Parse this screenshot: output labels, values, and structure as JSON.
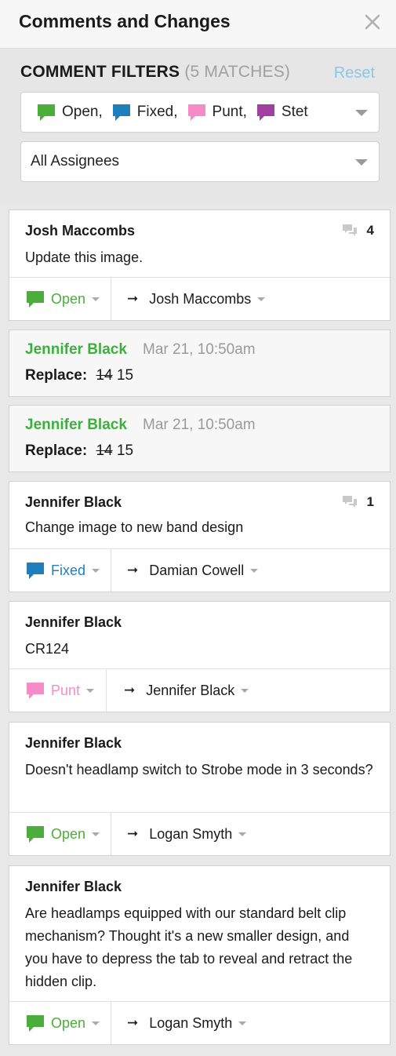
{
  "panel": {
    "title": "Comments and Changes",
    "close_symbol": "✕"
  },
  "filters": {
    "title": "COMMENT FILTERS",
    "matches": "(5 MATCHES)",
    "reset_label": "Reset",
    "statuses": [
      {
        "label": "Open,",
        "icon": "comment-bubble-green-icon",
        "color": "#4cae3a"
      },
      {
        "label": "Fixed,",
        "icon": "comment-bubble-blue-icon",
        "color": "#1f7fbd"
      },
      {
        "label": "Punt,",
        "icon": "comment-bubble-pink-icon",
        "color": "#f58cc8"
      },
      {
        "label": "Stet",
        "icon": "comment-bubble-purple-icon",
        "color": "#a040a0"
      }
    ],
    "assignee_select": "All Assignees"
  },
  "cards": [
    {
      "author": "Josh Maccombs",
      "body": "Update this image.",
      "reply_count": "4",
      "status": "Open",
      "status_color": "#4cae3a",
      "assignee": "Josh Maccombs",
      "arrow": "➞"
    },
    {
      "author": "Jennifer Black",
      "date": "Mar 21, 10:50am",
      "replace_label": "Replace:",
      "old": "14",
      "new": "15"
    },
    {
      "author": "Jennifer Black",
      "date": "Mar 21, 10:50am",
      "replace_label": "Replace:",
      "old": "14",
      "new": "15"
    },
    {
      "author": "Jennifer Black",
      "body": "Change image to new band design",
      "reply_count": "1",
      "status": "Fixed",
      "status_color": "#1f7fbd",
      "assignee": "Damian Cowell",
      "arrow": "➞"
    },
    {
      "author": "Jennifer Black",
      "body": "CR124",
      "status": "Punt",
      "status_color": "#f58cc8",
      "assignee": "Jennifer Black",
      "arrow": "➞"
    },
    {
      "author": "Jennifer Black",
      "body": "Doesn't headlamp switch to Strobe mode in  3 seconds?",
      "status": "Open",
      "status_color": "#4cae3a",
      "assignee": "Logan Smyth",
      "arrow": "➞"
    },
    {
      "author": "Jennifer Black",
      "body": "Are headlamps equipped with our standard belt clip mechanism? Thought it's a new smaller design, and you have to depress the tab to reveal and retract the hidden clip.",
      "status": "Open",
      "status_color": "#4cae3a",
      "assignee": "Logan Smyth",
      "arrow": "➞"
    }
  ]
}
